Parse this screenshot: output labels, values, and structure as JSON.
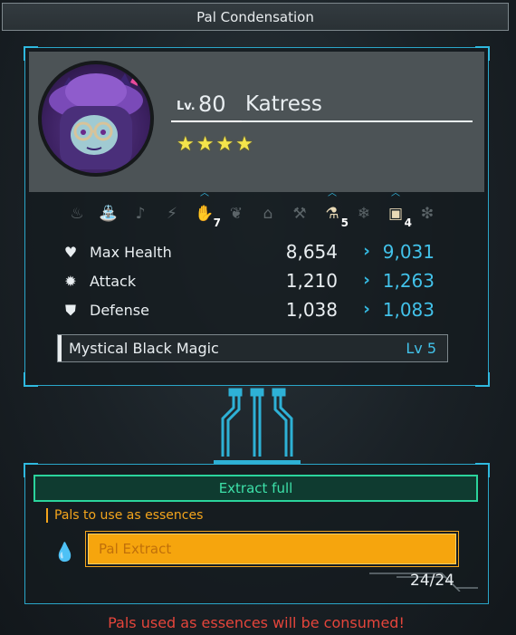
{
  "window": {
    "title": "Pal Condensation"
  },
  "pal": {
    "level_label": "Lv.",
    "level": "80",
    "name": "Katress",
    "stars": "★★★★"
  },
  "work_suitability": [
    {
      "icon": "kindling-icon",
      "active": false,
      "level": ""
    },
    {
      "icon": "watering-icon",
      "active": false,
      "level": ""
    },
    {
      "icon": "planting-icon",
      "active": false,
      "level": ""
    },
    {
      "icon": "electricity-icon",
      "active": false,
      "level": ""
    },
    {
      "icon": "handiwork-icon",
      "active": true,
      "level": "7"
    },
    {
      "icon": "gathering-icon",
      "active": false,
      "level": ""
    },
    {
      "icon": "lumbering-icon",
      "active": false,
      "level": ""
    },
    {
      "icon": "mining-icon",
      "active": false,
      "level": ""
    },
    {
      "icon": "medicine-icon",
      "active": true,
      "level": "5"
    },
    {
      "icon": "cooling-icon",
      "active": false,
      "level": ""
    },
    {
      "icon": "transporting-icon",
      "active": true,
      "level": "4"
    },
    {
      "icon": "farming-icon",
      "active": false,
      "level": ""
    }
  ],
  "stats": [
    {
      "icon": "heart-icon",
      "label": "Max Health",
      "current": "8,654",
      "next": "9,031"
    },
    {
      "icon": "attack-icon",
      "label": "Attack",
      "current": "1,210",
      "next": "1,263"
    },
    {
      "icon": "shield-icon",
      "label": "Defense",
      "current": "1,038",
      "next": "1,083"
    }
  ],
  "skill": {
    "name": "Mystical Black Magic",
    "level": "Lv  5"
  },
  "extract": {
    "status": "Extract full",
    "essence_label": "Pals to use as essences",
    "slot_placeholder": "Pal Extract",
    "count": "24/24"
  },
  "warning": "Pals used as essences will be consumed!",
  "colors": {
    "accent_blue": "#34b8e0",
    "accent_green": "#2bd49c",
    "accent_orange": "#f4a51c",
    "warning_red": "#e4453b",
    "star_yellow": "#f4e44b"
  }
}
